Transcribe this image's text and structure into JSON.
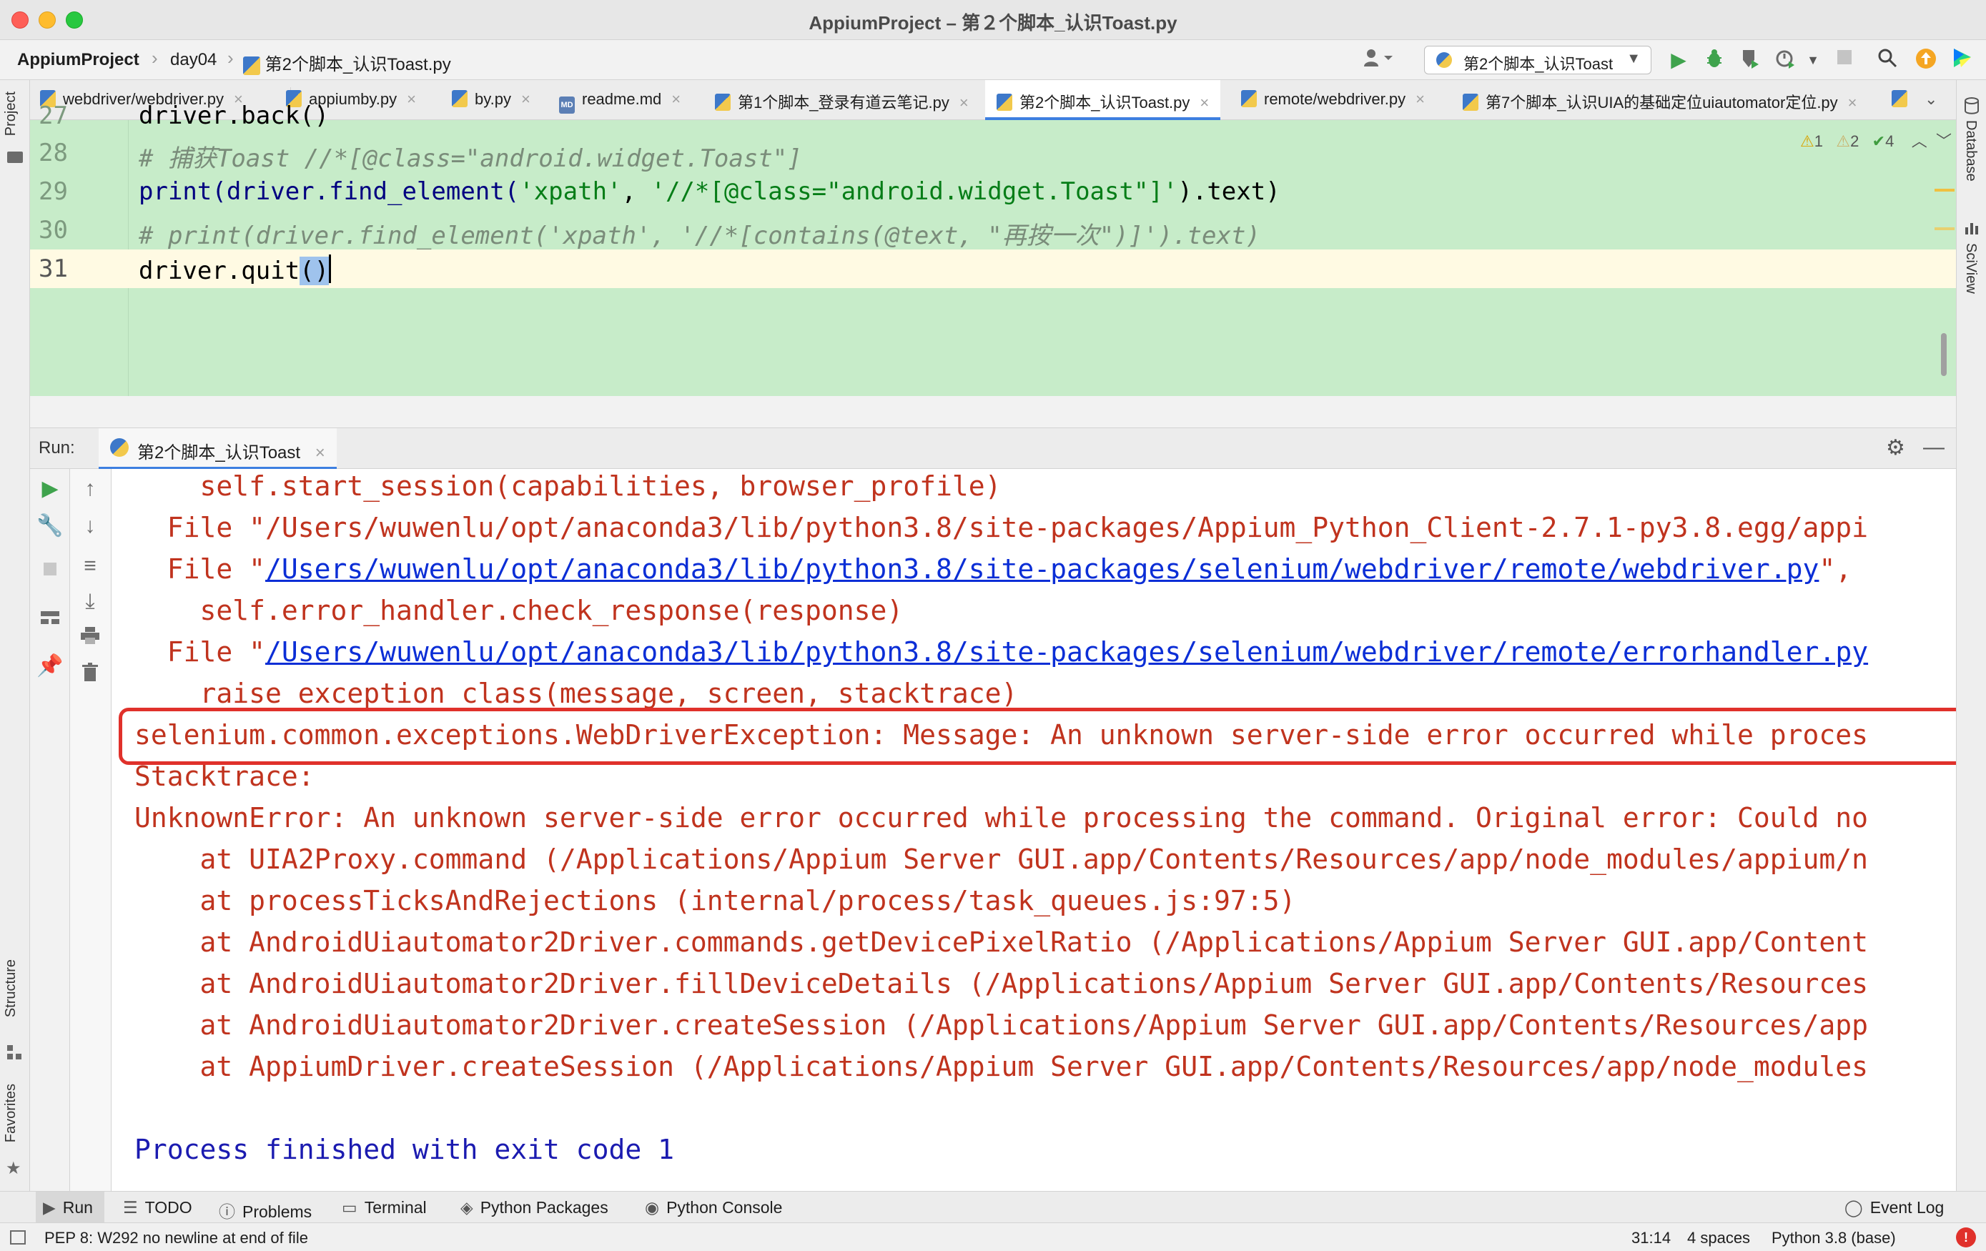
{
  "window": {
    "title": "AppiumProject – 第２个脚本_认识Toast.py",
    "colors": {
      "close": "#fe5f57",
      "minimize": "#febc2e",
      "maximize": "#28c840"
    }
  },
  "breadcrumb": {
    "project": "AppiumProject",
    "folder": "day04",
    "file": "第2个脚本_认识Toast.py"
  },
  "toolbar": {
    "run_config": "第2个脚本_认识Toast",
    "icons": [
      "user-icon",
      "run-icon",
      "debug-icon",
      "coverage-icon",
      "profile-icon",
      "stop-icon",
      "search-icon",
      "update-icon",
      "jetbrains-icon"
    ]
  },
  "left_tools": {
    "project": "Project",
    "structure": "Structure",
    "favorites": "Favorites"
  },
  "right_tools": {
    "database": "Database",
    "sciview": "SciView"
  },
  "tabs": [
    {
      "label": "webdriver/webdriver.py",
      "icon": "python-file-icon",
      "active": false
    },
    {
      "label": "appiumby.py",
      "icon": "python-file-icon",
      "active": false
    },
    {
      "label": "by.py",
      "icon": "python-file-icon",
      "active": false
    },
    {
      "label": "readme.md",
      "icon": "markdown-file-icon",
      "active": false
    },
    {
      "label": "第1个脚本_登录有道云笔记.py",
      "icon": "python-file-icon",
      "active": false
    },
    {
      "label": "第2个脚本_认识Toast.py",
      "icon": "python-file-icon",
      "active": true
    },
    {
      "label": "remote/webdriver.py",
      "icon": "python-file-icon",
      "active": false
    },
    {
      "label": "第7个脚本_认识UIA的基础定位uiautomator定位.py",
      "icon": "python-file-icon",
      "active": false
    }
  ],
  "editor": {
    "lines": [
      {
        "num": "27",
        "code": "driver.back()"
      },
      {
        "num": "28",
        "code": "# 捕获Toast //*[@class=\"android.widget.Toast\"]"
      },
      {
        "num": "29",
        "code": "print(driver.find_element('xpath', '//*[@class=\"android.widget.Toast\"]').text)"
      },
      {
        "num": "30",
        "code": "# print(driver.find_element('xpath', '//*[contains(@text, \"再按一次\")]').text)"
      },
      {
        "num": "31",
        "code": "driver.quit()"
      }
    ],
    "inspections": {
      "warnings": "1",
      "weak_warnings": "2",
      "ok": "4"
    }
  },
  "run_panel": {
    "label": "Run:",
    "tab": "第2个脚本_认识Toast",
    "console": [
      {
        "text": "    self.start_session(capabilities, browser_profile)",
        "kind": "error"
      },
      {
        "text": "  File \"/Users/wuwenlu/opt/anaconda3/lib/python3.8/site-packages/Appium_Python_Client-2.7.1-py3.8.egg/appi",
        "kind": "error"
      },
      {
        "prefix": "  File \"",
        "link": "/Users/wuwenlu/opt/anaconda3/lib/python3.8/site-packages/selenium/webdriver/remote/webdriver.py",
        "suffix": "\",",
        "kind": "error-link"
      },
      {
        "text": "    self.error_handler.check_response(response)",
        "kind": "error"
      },
      {
        "prefix": "  File \"",
        "link": "/Users/wuwenlu/opt/anaconda3/lib/python3.8/site-packages/selenium/webdriver/remote/errorhandler.py",
        "suffix": "",
        "kind": "error-link"
      },
      {
        "text": "    raise exception_class(message, screen, stacktrace)",
        "kind": "error"
      },
      {
        "text": "selenium.common.exceptions.WebDriverException: Message: An unknown server-side error occurred while proces",
        "kind": "error"
      },
      {
        "text": "Stacktrace:",
        "kind": "error"
      },
      {
        "text": "UnknownError: An unknown server-side error occurred while processing the command. Original error: Could no",
        "kind": "error"
      },
      {
        "text": "    at UIA2Proxy.command (/Applications/Appium Server GUI.app/Contents/Resources/app/node_modules/appium/n",
        "kind": "error"
      },
      {
        "text": "    at processTicksAndRejections (internal/process/task_queues.js:97:5)",
        "kind": "error"
      },
      {
        "text": "    at AndroidUiautomator2Driver.commands.getDevicePixelRatio (/Applications/Appium Server GUI.app/Content",
        "kind": "error"
      },
      {
        "text": "    at AndroidUiautomator2Driver.fillDeviceDetails (/Applications/Appium Server GUI.app/Contents/Resources",
        "kind": "error"
      },
      {
        "text": "    at AndroidUiautomator2Driver.createSession (/Applications/Appium Server GUI.app/Contents/Resources/app",
        "kind": "error"
      },
      {
        "text": "    at AppiumDriver.createSession (/Applications/Appium Server GUI.app/Contents/Resources/app/node_modules",
        "kind": "error"
      },
      {
        "text": "",
        "kind": "blank"
      },
      {
        "text": "Process finished with exit code 1",
        "kind": "info"
      }
    ]
  },
  "bottom_tools": [
    {
      "label": "Run",
      "icon": "run-icon",
      "active": true
    },
    {
      "label": "TODO",
      "icon": "list-icon",
      "active": false
    },
    {
      "label": "Problems",
      "icon": "problems-icon",
      "active": false
    },
    {
      "label": "Terminal",
      "icon": "terminal-icon",
      "active": false
    },
    {
      "label": "Python Packages",
      "icon": "packages-icon",
      "active": false
    },
    {
      "label": "Python Console",
      "icon": "python-console-icon",
      "active": false
    },
    {
      "label": "Event Log",
      "icon": "event-log-icon",
      "active": false
    }
  ],
  "status": {
    "message": "PEP 8: W292 no newline at end of file",
    "position": "31:14",
    "indent": "4 spaces",
    "interpreter": "Python 3.8 (base)"
  }
}
